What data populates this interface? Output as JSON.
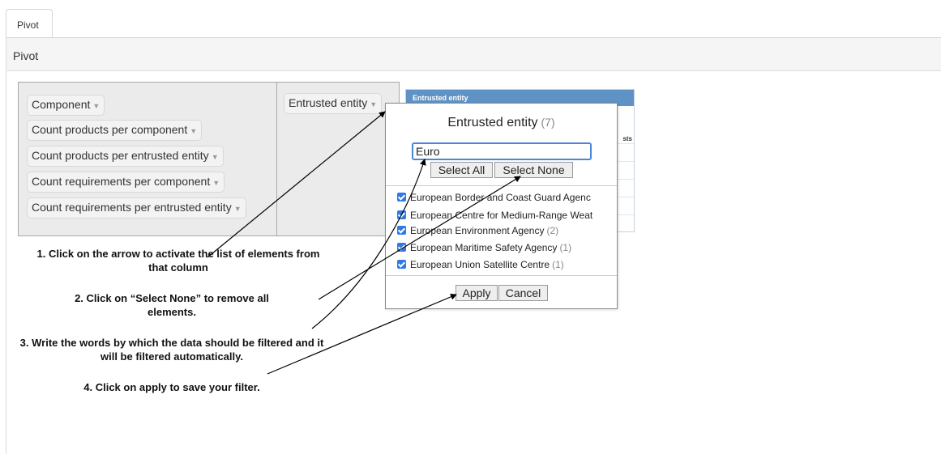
{
  "tabs": [
    {
      "label": "Pivot"
    }
  ],
  "panel": {
    "title": "Pivot"
  },
  "unused_fields": [
    {
      "label": "Component"
    },
    {
      "label": "Count products per component"
    },
    {
      "label": "Count products per entrusted entity"
    },
    {
      "label": "Count requirements per component"
    },
    {
      "label": "Count requirements per entrusted entity"
    }
  ],
  "row_fields": [
    {
      "label": "Entrusted entity"
    }
  ],
  "result_table": {
    "header": "Entrusted entity",
    "partial_text": "sts"
  },
  "filter_popup": {
    "title": "Entrusted entity",
    "count": "(7)",
    "search_value": "Euro",
    "select_all_label": "Select All",
    "select_none_label": "Select None",
    "items": [
      {
        "label": "European Border and Coast Guard Agenc",
        "count": "",
        "checked": true
      },
      {
        "label": "European Centre for Medium-Range Weat",
        "count": "",
        "checked": true
      },
      {
        "label": "European Environment Agency",
        "count": "(2)",
        "checked": true
      },
      {
        "label": "European Maritime Safety Agency",
        "count": "(1)",
        "checked": true
      },
      {
        "label": "European Union Satellite Centre",
        "count": "(1)",
        "checked": true
      }
    ],
    "apply_label": "Apply",
    "cancel_label": "Cancel"
  },
  "instructions": [
    {
      "text": "1. Click on the arrow to activate the list of elements from that column"
    },
    {
      "text": "2. Click on “Select None” to remove all elements."
    },
    {
      "text": "3. Write the words by which the data should be filtered and it will be filtered automatically."
    },
    {
      "text": "4. Click on apply to save your filter."
    }
  ],
  "colors": {
    "accent": "#4a86d8",
    "checkbox": "#2f7ae5",
    "table_header": "#5f93c6",
    "pivot_area": "#ebebeb"
  }
}
